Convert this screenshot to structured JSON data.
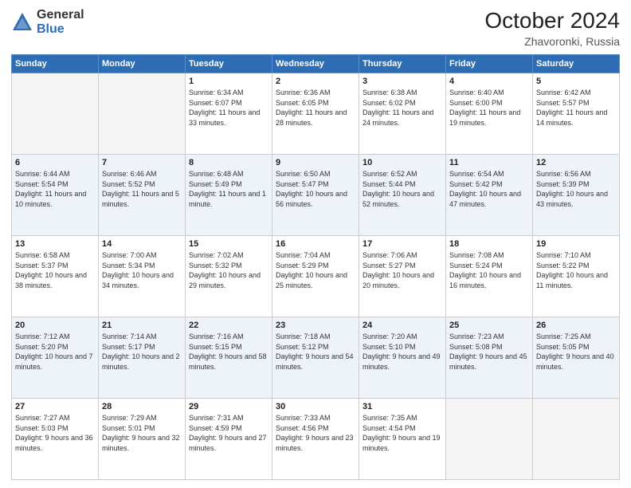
{
  "header": {
    "logo_general": "General",
    "logo_blue": "Blue",
    "month_title": "October 2024",
    "location": "Zhavoronki, Russia"
  },
  "days_of_week": [
    "Sunday",
    "Monday",
    "Tuesday",
    "Wednesday",
    "Thursday",
    "Friday",
    "Saturday"
  ],
  "weeks": [
    [
      {
        "day": "",
        "info": ""
      },
      {
        "day": "",
        "info": ""
      },
      {
        "day": "1",
        "info": "Sunrise: 6:34 AM\nSunset: 6:07 PM\nDaylight: 11 hours\nand 33 minutes."
      },
      {
        "day": "2",
        "info": "Sunrise: 6:36 AM\nSunset: 6:05 PM\nDaylight: 11 hours\nand 28 minutes."
      },
      {
        "day": "3",
        "info": "Sunrise: 6:38 AM\nSunset: 6:02 PM\nDaylight: 11 hours\nand 24 minutes."
      },
      {
        "day": "4",
        "info": "Sunrise: 6:40 AM\nSunset: 6:00 PM\nDaylight: 11 hours\nand 19 minutes."
      },
      {
        "day": "5",
        "info": "Sunrise: 6:42 AM\nSunset: 5:57 PM\nDaylight: 11 hours\nand 14 minutes."
      }
    ],
    [
      {
        "day": "6",
        "info": "Sunrise: 6:44 AM\nSunset: 5:54 PM\nDaylight: 11 hours\nand 10 minutes."
      },
      {
        "day": "7",
        "info": "Sunrise: 6:46 AM\nSunset: 5:52 PM\nDaylight: 11 hours\nand 5 minutes."
      },
      {
        "day": "8",
        "info": "Sunrise: 6:48 AM\nSunset: 5:49 PM\nDaylight: 11 hours\nand 1 minute."
      },
      {
        "day": "9",
        "info": "Sunrise: 6:50 AM\nSunset: 5:47 PM\nDaylight: 10 hours\nand 56 minutes."
      },
      {
        "day": "10",
        "info": "Sunrise: 6:52 AM\nSunset: 5:44 PM\nDaylight: 10 hours\nand 52 minutes."
      },
      {
        "day": "11",
        "info": "Sunrise: 6:54 AM\nSunset: 5:42 PM\nDaylight: 10 hours\nand 47 minutes."
      },
      {
        "day": "12",
        "info": "Sunrise: 6:56 AM\nSunset: 5:39 PM\nDaylight: 10 hours\nand 43 minutes."
      }
    ],
    [
      {
        "day": "13",
        "info": "Sunrise: 6:58 AM\nSunset: 5:37 PM\nDaylight: 10 hours\nand 38 minutes."
      },
      {
        "day": "14",
        "info": "Sunrise: 7:00 AM\nSunset: 5:34 PM\nDaylight: 10 hours\nand 34 minutes."
      },
      {
        "day": "15",
        "info": "Sunrise: 7:02 AM\nSunset: 5:32 PM\nDaylight: 10 hours\nand 29 minutes."
      },
      {
        "day": "16",
        "info": "Sunrise: 7:04 AM\nSunset: 5:29 PM\nDaylight: 10 hours\nand 25 minutes."
      },
      {
        "day": "17",
        "info": "Sunrise: 7:06 AM\nSunset: 5:27 PM\nDaylight: 10 hours\nand 20 minutes."
      },
      {
        "day": "18",
        "info": "Sunrise: 7:08 AM\nSunset: 5:24 PM\nDaylight: 10 hours\nand 16 minutes."
      },
      {
        "day": "19",
        "info": "Sunrise: 7:10 AM\nSunset: 5:22 PM\nDaylight: 10 hours\nand 11 minutes."
      }
    ],
    [
      {
        "day": "20",
        "info": "Sunrise: 7:12 AM\nSunset: 5:20 PM\nDaylight: 10 hours\nand 7 minutes."
      },
      {
        "day": "21",
        "info": "Sunrise: 7:14 AM\nSunset: 5:17 PM\nDaylight: 10 hours\nand 2 minutes."
      },
      {
        "day": "22",
        "info": "Sunrise: 7:16 AM\nSunset: 5:15 PM\nDaylight: 9 hours\nand 58 minutes."
      },
      {
        "day": "23",
        "info": "Sunrise: 7:18 AM\nSunset: 5:12 PM\nDaylight: 9 hours\nand 54 minutes."
      },
      {
        "day": "24",
        "info": "Sunrise: 7:20 AM\nSunset: 5:10 PM\nDaylight: 9 hours\nand 49 minutes."
      },
      {
        "day": "25",
        "info": "Sunrise: 7:23 AM\nSunset: 5:08 PM\nDaylight: 9 hours\nand 45 minutes."
      },
      {
        "day": "26",
        "info": "Sunrise: 7:25 AM\nSunset: 5:05 PM\nDaylight: 9 hours\nand 40 minutes."
      }
    ],
    [
      {
        "day": "27",
        "info": "Sunrise: 7:27 AM\nSunset: 5:03 PM\nDaylight: 9 hours\nand 36 minutes."
      },
      {
        "day": "28",
        "info": "Sunrise: 7:29 AM\nSunset: 5:01 PM\nDaylight: 9 hours\nand 32 minutes."
      },
      {
        "day": "29",
        "info": "Sunrise: 7:31 AM\nSunset: 4:59 PM\nDaylight: 9 hours\nand 27 minutes."
      },
      {
        "day": "30",
        "info": "Sunrise: 7:33 AM\nSunset: 4:56 PM\nDaylight: 9 hours\nand 23 minutes."
      },
      {
        "day": "31",
        "info": "Sunrise: 7:35 AM\nSunset: 4:54 PM\nDaylight: 9 hours\nand 19 minutes."
      },
      {
        "day": "",
        "info": ""
      },
      {
        "day": "",
        "info": ""
      }
    ]
  ]
}
